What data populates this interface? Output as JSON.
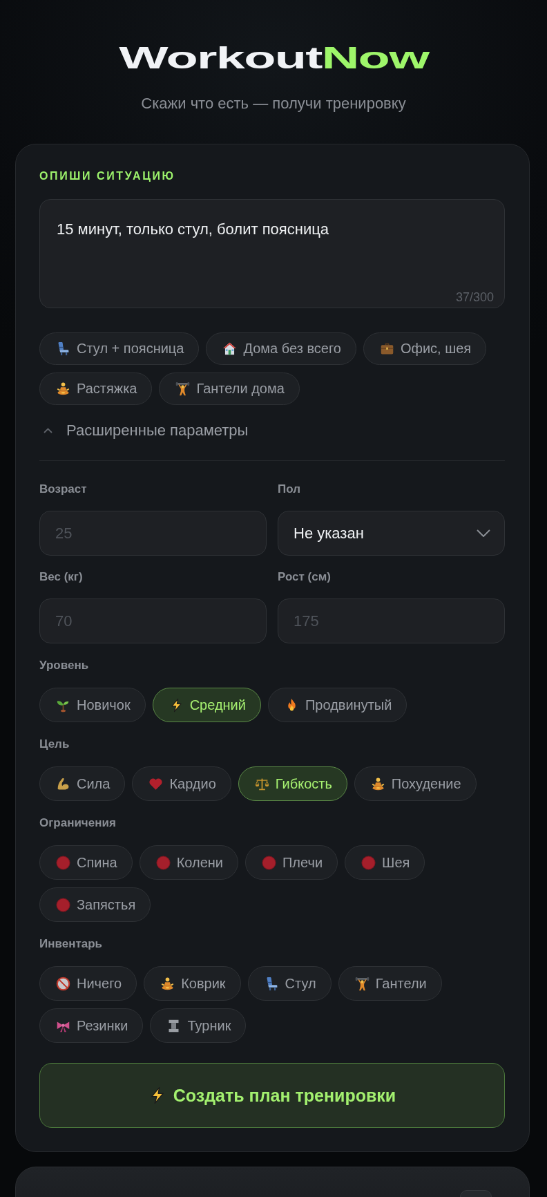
{
  "header": {
    "logo": {
      "text": "Workout",
      "accent": "Now"
    },
    "subtitle": "Скажи что есть — получи тренировку"
  },
  "form": {
    "section_label": "ОПИШИ СИТУАЦИЮ",
    "description": {
      "value": "15 минут, только стул, болит поясница",
      "counter": "37/300"
    },
    "presets": [
      "Стул + поясница",
      "Дома без всего",
      "Офис, шея",
      "Растяжка",
      "Гантели дома"
    ],
    "advanced": {
      "label": "Расширенные параметры",
      "expanded": true
    },
    "fields": [
      {
        "kind": "input",
        "label": "Возраст",
        "placeholder": "25"
      },
      {
        "kind": "select",
        "label": "Пол",
        "value": "Не указан"
      },
      {
        "kind": "input",
        "label": "Вес (кг)",
        "placeholder": "70"
      },
      {
        "kind": "input",
        "label": "Рост (см)",
        "placeholder": "175"
      }
    ],
    "groups": [
      {
        "label": "Уровень",
        "options": [
          {
            "label": "Новичок",
            "selected": false
          },
          {
            "label": "Средний",
            "selected": true
          },
          {
            "label": "Продвинутый",
            "selected": false
          }
        ]
      },
      {
        "label": "Цель",
        "options": [
          {
            "label": "Сила",
            "selected": false
          },
          {
            "label": "Кардио",
            "selected": false
          },
          {
            "label": "Гибкость",
            "selected": true
          },
          {
            "label": "Похудение",
            "selected": false
          }
        ]
      },
      {
        "label": "Ограничения",
        "options": [
          {
            "label": "Спина",
            "selected": false
          },
          {
            "label": "Колени",
            "selected": false
          },
          {
            "label": "Плечи",
            "selected": false
          },
          {
            "label": "Шея",
            "selected": false
          },
          {
            "label": "Запястья",
            "selected": false
          }
        ]
      },
      {
        "label": "Инвентарь",
        "options": [
          {
            "label": "Ничего",
            "selected": false
          },
          {
            "label": "Коврик",
            "selected": false
          },
          {
            "label": "Стул",
            "selected": false
          },
          {
            "label": "Гантели",
            "selected": false
          },
          {
            "label": "Резинки",
            "selected": false
          },
          {
            "label": "Турник",
            "selected": false
          }
        ]
      }
    ],
    "submit": "Создать план тренировки"
  }
}
